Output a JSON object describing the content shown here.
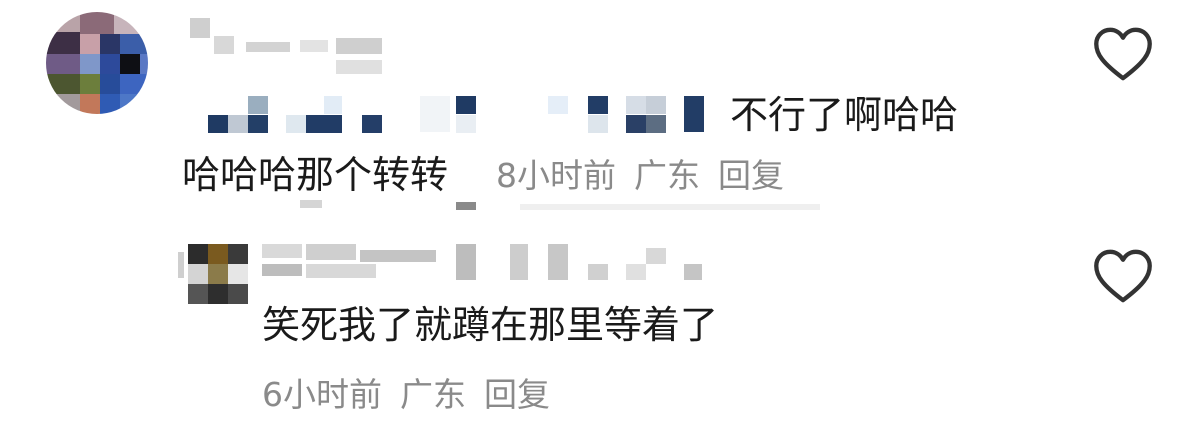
{
  "comments": [
    {
      "text_tail": "不行了啊哈哈",
      "text_line2": "哈哈哈那个转转",
      "time": "8小时前",
      "location": "广东",
      "reply_label": "回复"
    },
    {
      "text": "笑死我了就蹲在那里等着了",
      "time": "6小时前",
      "location": "广东",
      "reply_label": "回复"
    }
  ],
  "icons": {
    "like": "heart-outline-icon"
  },
  "colors": {
    "text": "#1a1a1a",
    "meta": "#8a8a8a",
    "icon": "#333333"
  }
}
